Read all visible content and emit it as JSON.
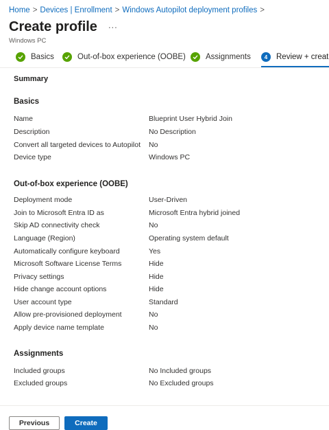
{
  "breadcrumb": [
    {
      "label": "Home"
    },
    {
      "label": "Devices | Enrollment"
    },
    {
      "label": "Windows Autopilot deployment profiles"
    }
  ],
  "breadcrumb_trailing_sep": ">",
  "title": "Create profile",
  "more_label": "...",
  "subtitle": "Windows PC",
  "steps": [
    {
      "label": "Basics",
      "state": "done"
    },
    {
      "label": "Out-of-box experience (OOBE)",
      "state": "done"
    },
    {
      "label": "Assignments",
      "state": "done"
    },
    {
      "label": "Review + create",
      "state": "current",
      "number": "4"
    }
  ],
  "summary_heading": "Summary",
  "basics": {
    "heading": "Basics",
    "rows": [
      {
        "label": "Name",
        "value": "Blueprint User Hybrid Join"
      },
      {
        "label": "Description",
        "value": "No Description"
      },
      {
        "label": "Convert all targeted devices to Autopilot",
        "value": "No"
      },
      {
        "label": "Device type",
        "value": "Windows PC"
      }
    ]
  },
  "oobe": {
    "heading": "Out-of-box experience (OOBE)",
    "rows": [
      {
        "label": "Deployment mode",
        "value": "User-Driven"
      },
      {
        "label": "Join to Microsoft Entra ID as",
        "value": "Microsoft Entra hybrid joined"
      },
      {
        "label": "Skip AD connectivity check",
        "value": "No"
      },
      {
        "label": "Language (Region)",
        "value": "Operating system default"
      },
      {
        "label": "Automatically configure keyboard",
        "value": "Yes"
      },
      {
        "label": "Microsoft Software License Terms",
        "value": "Hide"
      },
      {
        "label": "Privacy settings",
        "value": "Hide"
      },
      {
        "label": "Hide change account options",
        "value": "Hide"
      },
      {
        "label": "User account type",
        "value": "Standard"
      },
      {
        "label": "Allow pre-provisioned deployment",
        "value": "No"
      },
      {
        "label": "Apply device name template",
        "value": "No"
      }
    ]
  },
  "assignments": {
    "heading": "Assignments",
    "rows": [
      {
        "label": "Included groups",
        "value": "No Included groups"
      },
      {
        "label": "Excluded groups",
        "value": "No Excluded groups"
      }
    ]
  },
  "footer": {
    "previous_label": "Previous",
    "create_label": "Create"
  },
  "colors": {
    "accent": "#0f6cbd",
    "success": "#57a300"
  }
}
